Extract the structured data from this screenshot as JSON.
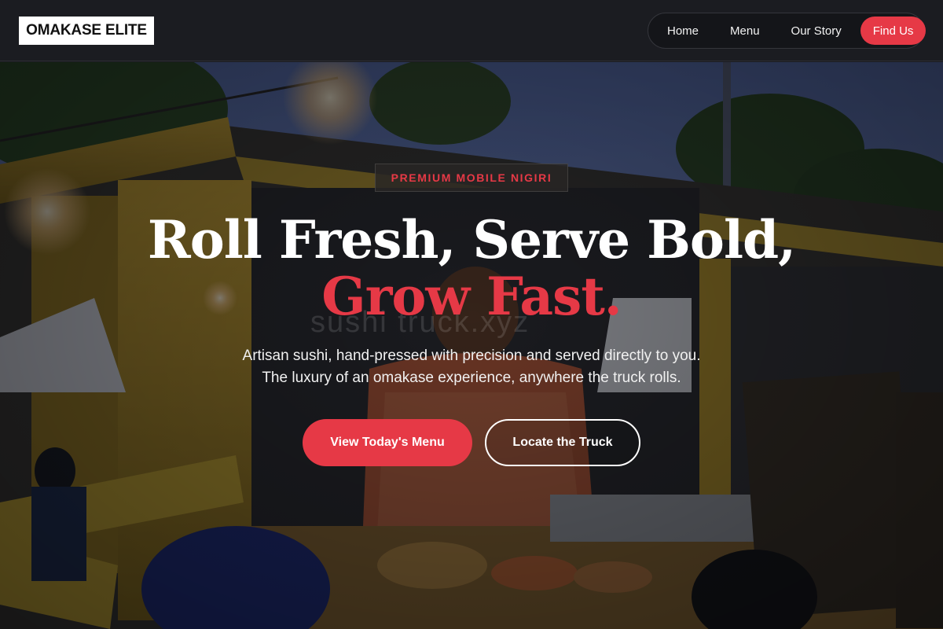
{
  "header": {
    "logo": "OMAKASE ELITE",
    "nav": [
      {
        "label": "Home"
      },
      {
        "label": "Menu"
      },
      {
        "label": "Our Story"
      },
      {
        "label": "Find Us"
      }
    ]
  },
  "hero": {
    "badge": "PREMIUM MOBILE NIGIRI",
    "headline_line1": "Roll Fresh, Serve Bold,",
    "headline_line2": "Grow Fast.",
    "subcopy_line1": "Artisan sushi, hand-pressed with precision and served directly to you.",
    "subcopy_line2": "The luxury of an omakase experience, anywhere the truck rolls.",
    "primary_button": "View Today's Menu",
    "secondary_button": "Locate the Truck",
    "watermark": "sushi truck.xyz"
  },
  "colors": {
    "accent": "#e63946",
    "header_bg": "#1b1c21"
  }
}
